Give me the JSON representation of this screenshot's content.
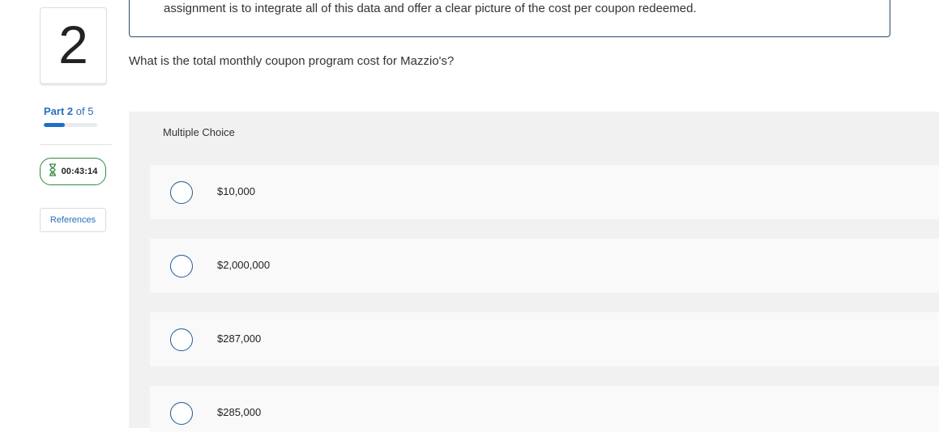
{
  "question_number": "2",
  "progress": {
    "part_word": "Part",
    "current": "2",
    "of_text": "of 5",
    "fraction": 0.4
  },
  "timer": {
    "value": "00:43:14",
    "icon": "hourglass-icon",
    "color": "#2e8b3e"
  },
  "references_label": "References",
  "context_text": "assignment is to integrate all of this data and offer a clear picture of the cost per coupon redeemed.",
  "question_text": "What is the total monthly coupon program cost for Mazzio's?",
  "answer": {
    "type_label": "Multiple Choice",
    "choices": [
      {
        "label": "$10,000"
      },
      {
        "label": "$2,000,000"
      },
      {
        "label": "$287,000"
      },
      {
        "label": "$285,000"
      }
    ]
  },
  "colors": {
    "accent": "#1f6fc5",
    "link": "#2a6ebb",
    "box_border": "#2c4a6e"
  }
}
